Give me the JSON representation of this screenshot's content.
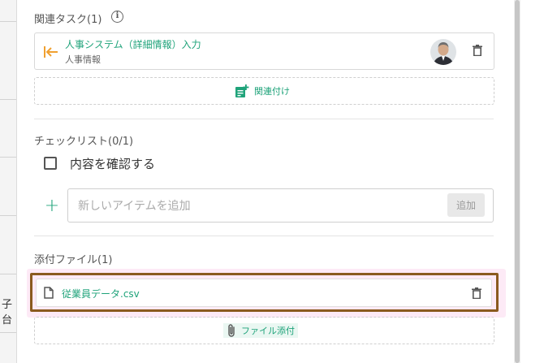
{
  "background": {
    "partial_text": "子台"
  },
  "related_tasks": {
    "title": "関連タスク(1)",
    "info_icon": "info-icon",
    "task": {
      "title": "人事システム（詳細情報）入力",
      "subtitle": "人事情報",
      "direction_icon": "arrow-to-left-icon"
    },
    "link_button": "関連付け"
  },
  "checklist": {
    "title": "チェックリスト(0/1)",
    "items": [
      {
        "label": "内容を確認する",
        "checked": false
      }
    ],
    "new_item_placeholder": "新しいアイテムを追加",
    "add_button": "追加"
  },
  "attachments": {
    "title": "添付ファイル(1)",
    "files": [
      {
        "name": "従業員データ.csv"
      }
    ],
    "attach_button": "ファイル添付"
  },
  "colors": {
    "accent": "#1fa37a",
    "orange_icon": "#f0a030",
    "highlight": "#8a5a1e"
  }
}
